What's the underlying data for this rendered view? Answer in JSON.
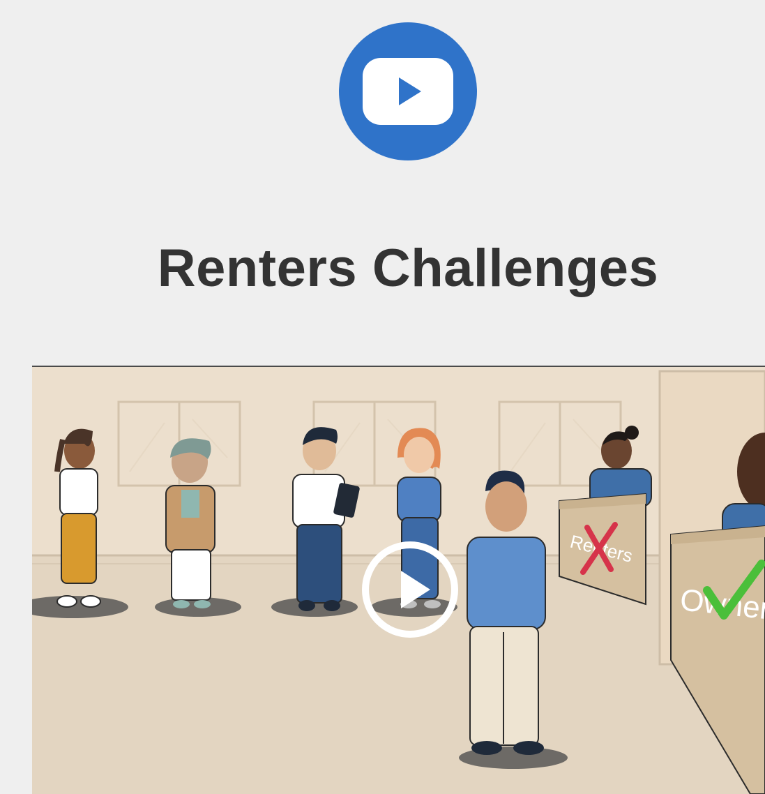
{
  "header": {
    "icon": "video-play-icon",
    "accent_color": "#2f73c9"
  },
  "title": "Renters Challenges",
  "video": {
    "thumbnail_icon": "play-circle-icon",
    "desk_left_label": "Renters",
    "desk_right_label": "Owners"
  }
}
